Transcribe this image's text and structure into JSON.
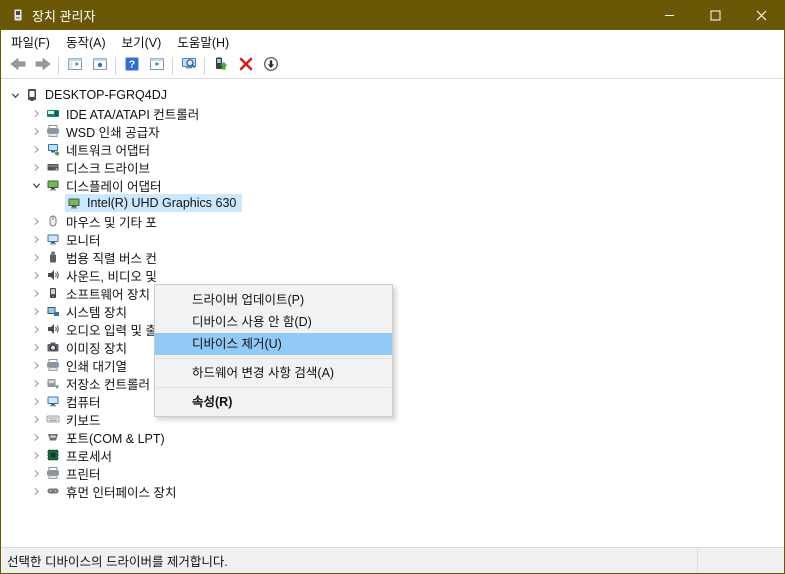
{
  "window": {
    "title": "장치 관리자",
    "controls": [
      {
        "name": "minimize"
      },
      {
        "name": "maximize"
      },
      {
        "name": "close"
      }
    ]
  },
  "menubar": {
    "items": [
      "파일(F)",
      "동작(A)",
      "보기(V)",
      "도움말(H)"
    ]
  },
  "toolbar": {
    "buttons": [
      "back",
      "forward",
      "sep",
      "show-hide-console-tree",
      "properties",
      "sep",
      "help",
      "show-hide-action-pane",
      "sep",
      "scan-hardware-changes",
      "sep",
      "update-driver",
      "uninstall-device",
      "disable-device"
    ]
  },
  "tree": {
    "items": [
      {
        "label": "DESKTOP-FGRQ4DJ",
        "level": 0,
        "state": "expanded",
        "icon": "computer"
      },
      {
        "label": "IDE ATA/ATAPI 컨트롤러",
        "level": 1,
        "state": "collapsed",
        "icon": "ide-controller"
      },
      {
        "label": "WSD 인쇄 공급자",
        "level": 1,
        "state": "collapsed",
        "icon": "printer"
      },
      {
        "label": "네트워크 어댑터",
        "level": 1,
        "state": "collapsed",
        "icon": "network-adapter"
      },
      {
        "label": "디스크 드라이브",
        "level": 1,
        "state": "collapsed",
        "icon": "disk-drive"
      },
      {
        "label": "디스플레이 어댑터",
        "level": 1,
        "state": "expanded",
        "icon": "display-adapter"
      },
      {
        "label": "Intel(R) UHD Graphics 630",
        "level": 2,
        "state": "leaf",
        "icon": "display-adapter",
        "selected": true
      },
      {
        "label": "마우스 및 기타 포",
        "level": 1,
        "state": "collapsed",
        "icon": "mouse"
      },
      {
        "label": "모니터",
        "level": 1,
        "state": "collapsed",
        "icon": "monitor"
      },
      {
        "label": "범용 직렬 버스 컨",
        "level": 1,
        "state": "collapsed",
        "icon": "usb"
      },
      {
        "label": "사운드, 비디오 및",
        "level": 1,
        "state": "collapsed",
        "icon": "sound"
      },
      {
        "label": "소프트웨어 장치",
        "level": 1,
        "state": "collapsed",
        "icon": "software-device"
      },
      {
        "label": "시스템 장치",
        "level": 1,
        "state": "collapsed",
        "icon": "system-device"
      },
      {
        "label": "오디오 입력 및 출",
        "level": 1,
        "state": "collapsed",
        "icon": "audio"
      },
      {
        "label": "이미징 장치",
        "level": 1,
        "state": "collapsed",
        "icon": "imaging"
      },
      {
        "label": "인쇄 대기열",
        "level": 1,
        "state": "collapsed",
        "icon": "print-queue"
      },
      {
        "label": "저장소 컨트롤러",
        "level": 1,
        "state": "collapsed",
        "icon": "storage-controller"
      },
      {
        "label": "컴퓨터",
        "level": 1,
        "state": "collapsed",
        "icon": "computer-monitor"
      },
      {
        "label": "키보드",
        "level": 1,
        "state": "collapsed",
        "icon": "keyboard"
      },
      {
        "label": "포트(COM & LPT)",
        "level": 1,
        "state": "collapsed",
        "icon": "port"
      },
      {
        "label": "프로세서",
        "level": 1,
        "state": "collapsed",
        "icon": "processor"
      },
      {
        "label": "프린터",
        "level": 1,
        "state": "collapsed",
        "icon": "printer"
      },
      {
        "label": "휴먼 인터페이스 장치",
        "level": 1,
        "state": "collapsed",
        "icon": "hid"
      }
    ]
  },
  "context_menu": {
    "items": [
      {
        "name": "update-driver",
        "label": "드라이버 업데이트(P)"
      },
      {
        "name": "disable-device",
        "label": "디바이스 사용 안 함(D)"
      },
      {
        "name": "uninstall-device",
        "label": "디바이스 제거(U)",
        "highlighted": true
      },
      {
        "separator": true
      },
      {
        "name": "scan-hardware-changes",
        "label": "하드웨어 변경 사항 검색(A)"
      },
      {
        "separator": true
      },
      {
        "name": "properties",
        "label": "속성(R)",
        "bold": true
      }
    ]
  },
  "statusbar": {
    "text": "선택한 디바이스의 드라이버를 제거합니다."
  },
  "colors": {
    "titlebar": "#6b5807",
    "tree_selection": "#cce8ff",
    "menu_highlight": "#91c9f7"
  }
}
